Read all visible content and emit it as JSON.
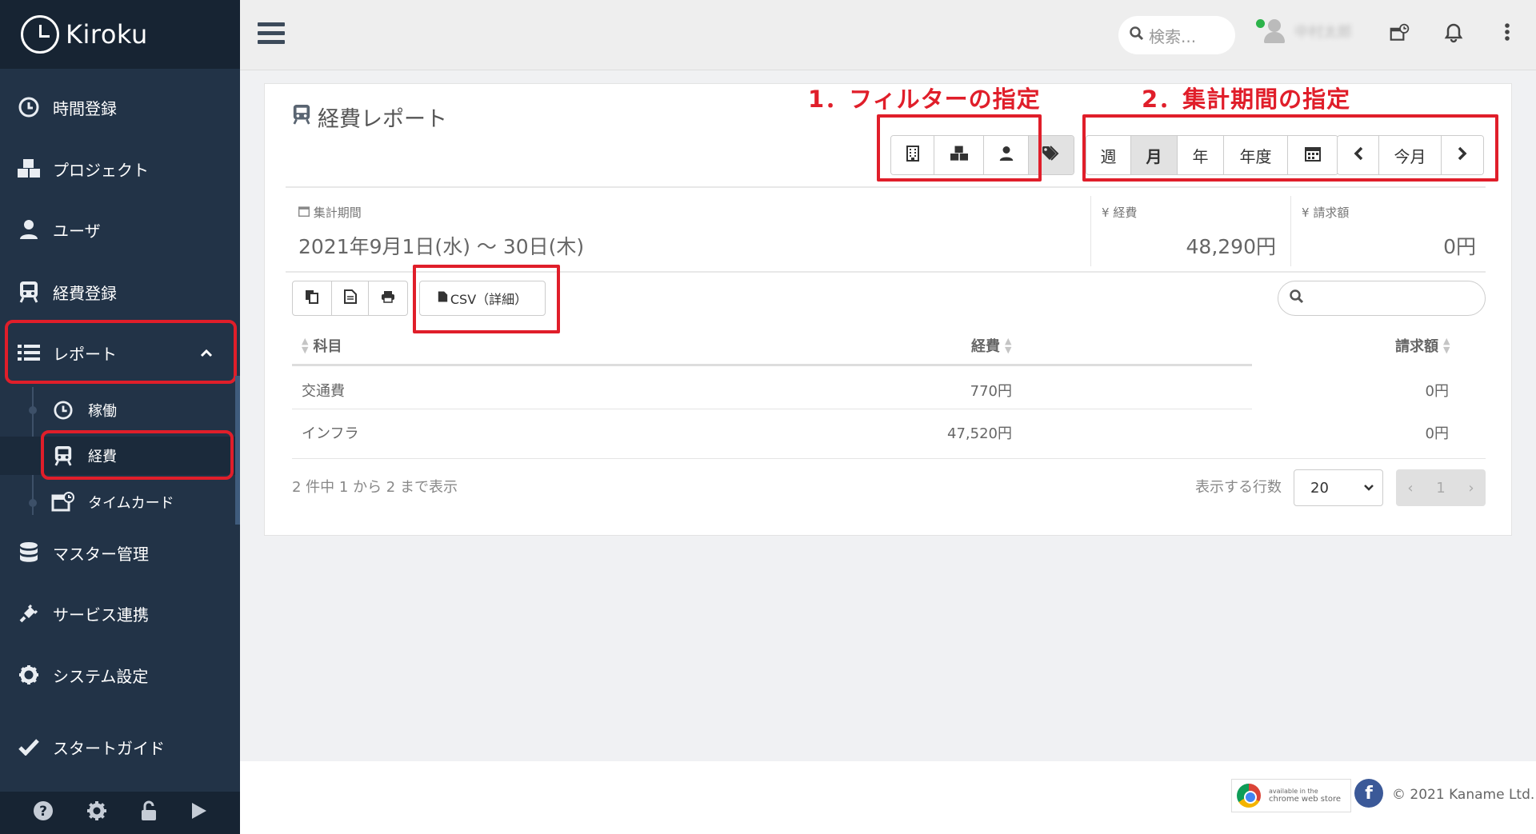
{
  "brand": {
    "name": "Kiroku"
  },
  "sidebar": {
    "items": [
      {
        "label": "時間登録",
        "icon": "clock-icon"
      },
      {
        "label": "プロジェクト",
        "icon": "cubes-icon"
      },
      {
        "label": "ユーザ",
        "icon": "user-icon"
      },
      {
        "label": "経費登録",
        "icon": "train-icon"
      },
      {
        "label": "レポート",
        "icon": "list-icon",
        "expanded": true
      },
      {
        "label": "マスター管理",
        "icon": "database-icon"
      },
      {
        "label": "サービス連携",
        "icon": "plug-icon"
      },
      {
        "label": "システム設定",
        "icon": "gear-icon"
      },
      {
        "label": "スタートガイド",
        "icon": "check-icon"
      }
    ],
    "sub_items": [
      {
        "label": "稼働",
        "icon": "clock-icon"
      },
      {
        "label": "経費",
        "icon": "train-icon",
        "active": true
      },
      {
        "label": "タイムカード",
        "icon": "timecard-icon"
      }
    ],
    "footer_icons": [
      "help-icon",
      "gear-icon",
      "unlock-icon",
      "play-icon"
    ]
  },
  "topbar": {
    "search_placeholder": "検索...",
    "user_name": "中村太郎"
  },
  "page": {
    "title": "経費レポート",
    "annotation_filter": "1．フィルターの指定",
    "annotation_period": "2．集計期間の指定",
    "filter_icons": [
      "building-icon",
      "cubes-icon",
      "user-icon",
      "tags-icon"
    ],
    "period_buttons": [
      "週",
      "月",
      "年",
      "年度"
    ],
    "period_active": "月",
    "nav_current": "今月",
    "period_label": "集計期間",
    "period_value": "2021年9月1日(水) ～ 30日(木)",
    "expense_label": "経費",
    "expense_value": "48,290円",
    "billing_label": "請求額",
    "billing_value": "0円",
    "csv_label": "CSV（詳細）"
  },
  "table": {
    "columns": [
      "科目",
      "経費",
      "請求額"
    ],
    "rows": [
      {
        "subject": "交通費",
        "expense": "770円",
        "billing": "0円"
      },
      {
        "subject": "インフラ",
        "expense": "47,520円",
        "billing": "0円"
      }
    ],
    "info": "2 件中 1 から 2 まで表示",
    "rows_label": "表示する行数",
    "rows_value": "20",
    "current_page": "1"
  },
  "footer": {
    "cws_line1": "available in the",
    "cws_line2": "chrome web store",
    "copyright": "© 2021 Kaname Ltd."
  },
  "colors": {
    "sidebar_bg": "#223347",
    "annotation_red": "#e01e2a"
  }
}
